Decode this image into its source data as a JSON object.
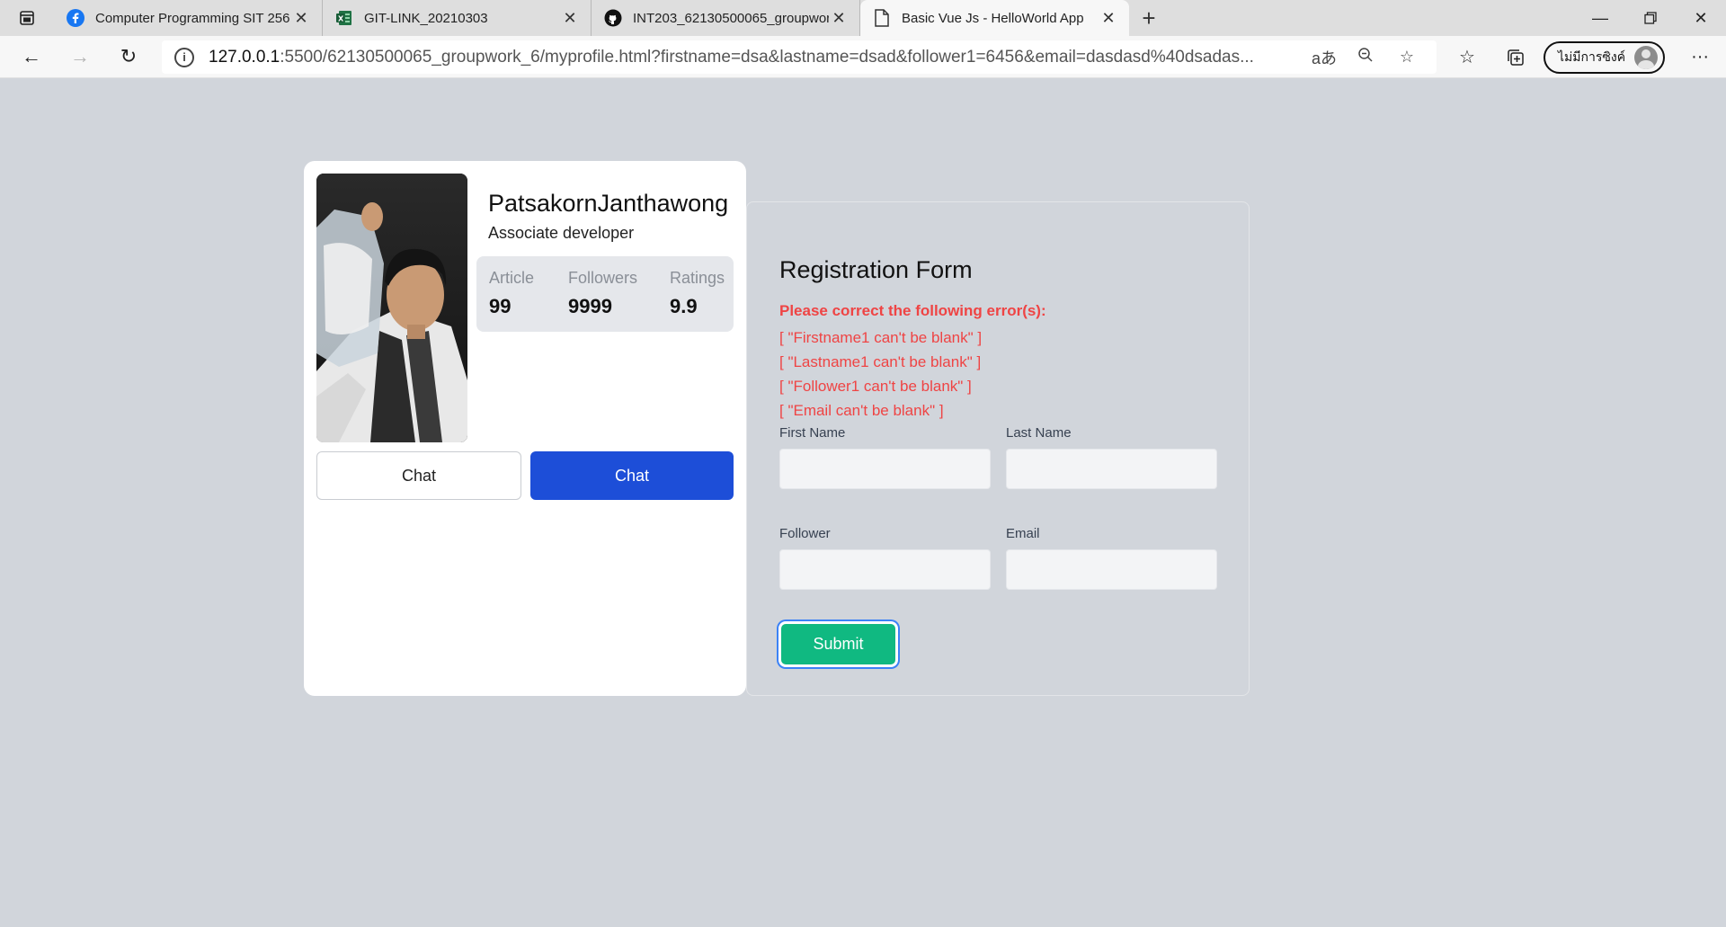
{
  "browser": {
    "tabs": [
      {
        "title": "Computer Programming SIT 256",
        "icon": "facebook-icon",
        "active": false
      },
      {
        "title": "GIT-LINK_20210303",
        "icon": "sheets-icon",
        "active": false
      },
      {
        "title": "INT203_62130500065_groupwor",
        "icon": "github-icon",
        "active": false
      },
      {
        "title": "Basic Vue Js - HelloWorld App",
        "icon": "page-icon",
        "active": true
      }
    ],
    "url_host": "127.0.0.1",
    "url_rest": ":5500/62130500065_groupwork_6/myprofile.html?firstname=dsa&lastname=dsad&follower1=6456&email=dasdasd%40dsadas...",
    "read_aloud": "aあ",
    "profile_label": "ไม่มีการซิงค์"
  },
  "profile": {
    "name": "PatsakornJanthawong",
    "role": "Associate developer",
    "stats": {
      "article_label": "Article",
      "article_value": "99",
      "followers_label": "Followers",
      "followers_value": "9999",
      "ratings_label": "Ratings",
      "ratings_value": "9.9"
    },
    "chat_outline_label": "Chat",
    "chat_primary_label": "Chat"
  },
  "form": {
    "title": "Registration Form",
    "error_heading": "Please correct the following error(s):",
    "errors": [
      "[ \"Firstname1 can't be blank\" ]",
      "[ \"Lastname1 can't be blank\" ]",
      "[ \"Follower1 can't be blank\" ]",
      "[ \"Email can't be blank\" ]"
    ],
    "first_name_label": "First Name",
    "first_name_value": "",
    "last_name_label": "Last Name",
    "last_name_value": "",
    "follower_label": "Follower",
    "follower_value": "",
    "email_label": "Email",
    "email_value": "",
    "submit_label": "Submit"
  },
  "colors": {
    "page_bg": "#d1d5db",
    "primary_blue": "#1d4ed8",
    "submit_green": "#10b981",
    "error_red": "#ef4444"
  }
}
